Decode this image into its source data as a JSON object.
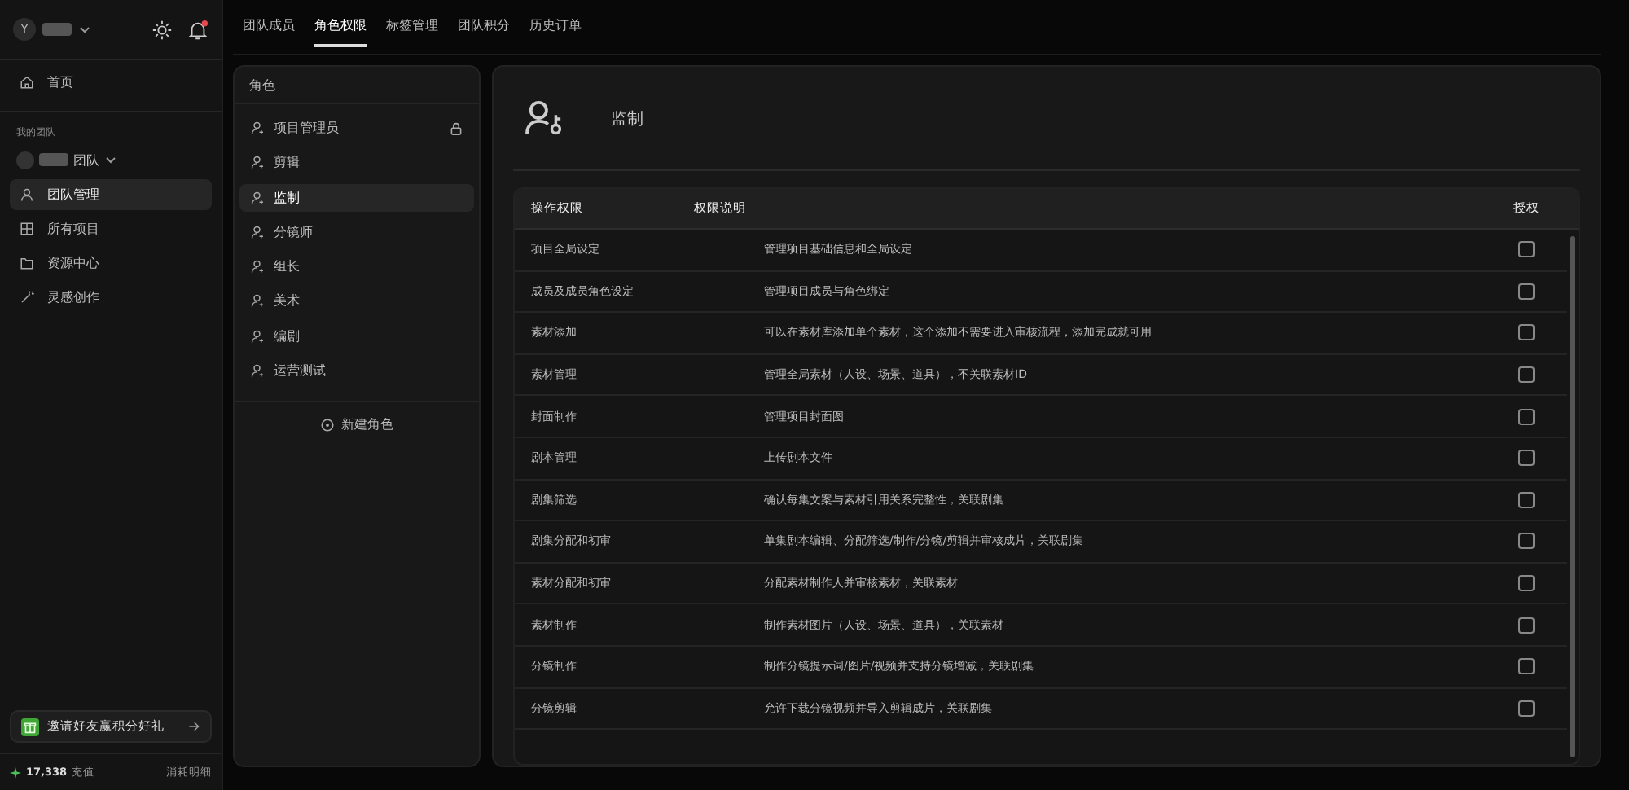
{
  "account": {
    "avatar_letter": "Y"
  },
  "sidebar": {
    "items": [
      {
        "label": "首页",
        "kind": "home",
        "selected": false
      }
    ],
    "section_label": "我的团队",
    "team_name": "团队",
    "team_items": [
      {
        "label": "团队管理",
        "kind": "user",
        "selected": true
      },
      {
        "label": "所有项目",
        "kind": "grid",
        "selected": false
      },
      {
        "label": "资源中心",
        "kind": "folder",
        "selected": false
      },
      {
        "label": "灵感创作",
        "kind": "wand",
        "selected": false
      }
    ],
    "invite": {
      "label": "邀请好友赢积分好礼"
    },
    "credits": {
      "amount": "17,338",
      "action": "充值",
      "details": "消耗明细"
    }
  },
  "tabs": [
    {
      "label": "团队成员",
      "selected": false
    },
    {
      "label": "角色权限",
      "selected": true
    },
    {
      "label": "标签管理",
      "selected": false
    },
    {
      "label": "团队积分",
      "selected": false
    },
    {
      "label": "历史订单",
      "selected": false
    }
  ],
  "roles": {
    "title": "角色",
    "items": [
      {
        "label": "项目管理员",
        "selected": false,
        "locked": true
      },
      {
        "label": "剪辑",
        "selected": false,
        "locked": false
      },
      {
        "label": "监制",
        "selected": true,
        "locked": false
      },
      {
        "label": "分镜师",
        "selected": false,
        "locked": false
      },
      {
        "label": "组长",
        "selected": false,
        "locked": false
      },
      {
        "label": "美术",
        "selected": false,
        "locked": false
      },
      {
        "label": "编剧",
        "selected": false,
        "locked": false
      },
      {
        "label": "运营测试",
        "selected": false,
        "locked": false
      }
    ],
    "add_button": "新建角色"
  },
  "detail": {
    "role_name": "监制",
    "table": {
      "columns": [
        "操作权限",
        "权限说明",
        "授权"
      ],
      "rows": [
        {
          "permission": "项目全局设定",
          "description": "管理项目基础信息和全局设定",
          "checked": false
        },
        {
          "permission": "成员及成员角色设定",
          "description": "管理项目成员与角色绑定",
          "checked": false
        },
        {
          "permission": "素材添加",
          "description": "可以在素材库添加单个素材，这个添加不需要进入审核流程，添加完成就可用",
          "checked": false
        },
        {
          "permission": "素材管理",
          "description": "管理全局素材（人设、场景、道具），不关联素材ID",
          "checked": false
        },
        {
          "permission": "封面制作",
          "description": "管理项目封面图",
          "checked": false
        },
        {
          "permission": "剧本管理",
          "description": "上传剧本文件",
          "checked": false
        },
        {
          "permission": "剧集筛选",
          "description": "确认每集文案与素材引用关系完整性，关联剧集",
          "checked": false
        },
        {
          "permission": "剧集分配和初审",
          "description": "单集剧本编辑、分配筛选/制作/分镜/剪辑并审核成片，关联剧集",
          "checked": false
        },
        {
          "permission": "素材分配和初审",
          "description": "分配素材制作人并审核素材，关联素材",
          "checked": false
        },
        {
          "permission": "素材制作",
          "description": "制作素材图片（人设、场景、道具），关联素材",
          "checked": false
        },
        {
          "permission": "分镜制作",
          "description": "制作分镜提示词/图片/视频并支持分镜增减，关联剧集",
          "checked": false
        },
        {
          "permission": "分镜剪辑",
          "description": "允许下载分镜视频并导入剪辑成片，关联剧集",
          "checked": false
        }
      ]
    }
  }
}
